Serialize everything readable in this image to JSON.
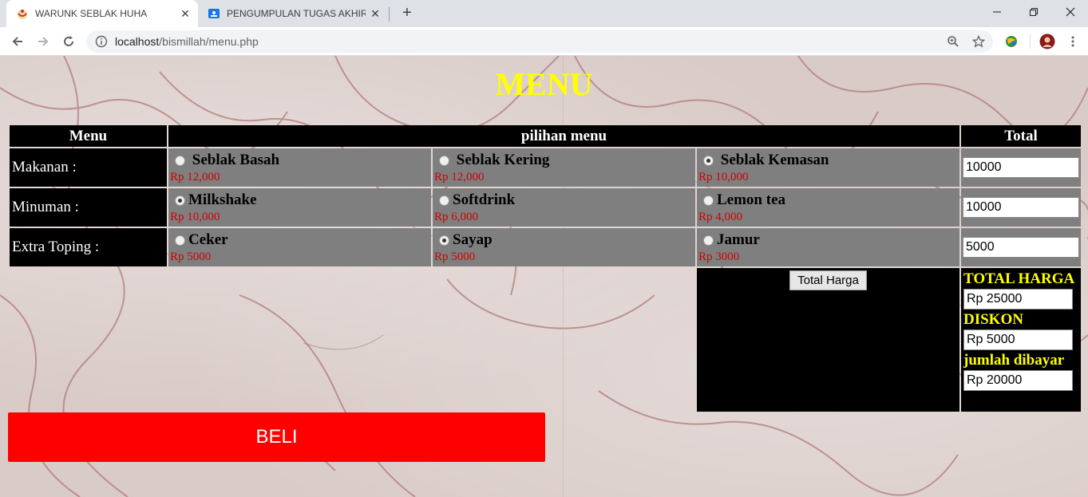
{
  "browser": {
    "tabs": [
      {
        "title": "WARUNK SEBLAK HUHA",
        "active": true
      },
      {
        "title": "PENGUMPULAN TUGAS AKHIR W",
        "active": false
      }
    ],
    "new_tab_symbol": "+",
    "url_host": "localhost",
    "url_path": "/bismillah/menu.php",
    "icons": [
      "back-icon",
      "forward-icon",
      "reload-icon",
      "info-icon",
      "zoom-icon",
      "star-icon",
      "extension-icon",
      "profile-avatar",
      "more-icon"
    ]
  },
  "page": {
    "title": "MENU",
    "headers": {
      "menu": "Menu",
      "choice": "pilihan menu",
      "total": "Total"
    },
    "rows": [
      {
        "label": "Makanan :",
        "options": [
          {
            "name": "Seblak Basah",
            "price": "Rp 12,000",
            "checked": false
          },
          {
            "name": "Seblak Kering",
            "price": "Rp 12,000",
            "checked": false
          },
          {
            "name": "Seblak Kemasan",
            "price": "Rp 10,000",
            "checked": true
          }
        ],
        "total": "10000"
      },
      {
        "label": "Minuman :",
        "options": [
          {
            "name": "Milkshake",
            "price": "Rp 10,000",
            "checked": true
          },
          {
            "name": "Softdrink",
            "price": "Rp 6,000",
            "checked": false
          },
          {
            "name": "Lemon tea",
            "price": "Rp 4,000",
            "checked": false
          }
        ],
        "total": "10000"
      },
      {
        "label": "Extra Toping :",
        "options": [
          {
            "name": "Ceker",
            "price": "Rp 5000",
            "checked": false
          },
          {
            "name": "Sayap",
            "price": "Rp 5000",
            "checked": true
          },
          {
            "name": "Jamur",
            "price": "Rp 3000",
            "checked": false
          }
        ],
        "total": "5000"
      }
    ],
    "calc_button": "Total Harga",
    "summary": {
      "total_label": "TOTAL HARGA",
      "total_value": "Rp 25000",
      "discount_label": "DISKON",
      "discount_value": "Rp 5000",
      "pay_label": "jumlah dibayar",
      "pay_value": "Rp 20000"
    },
    "buy_button": "BELI"
  },
  "colors": {
    "title": "#ffff00",
    "price": "#d00000",
    "buy": "#ff0000",
    "cell": "#7f7f7f"
  }
}
